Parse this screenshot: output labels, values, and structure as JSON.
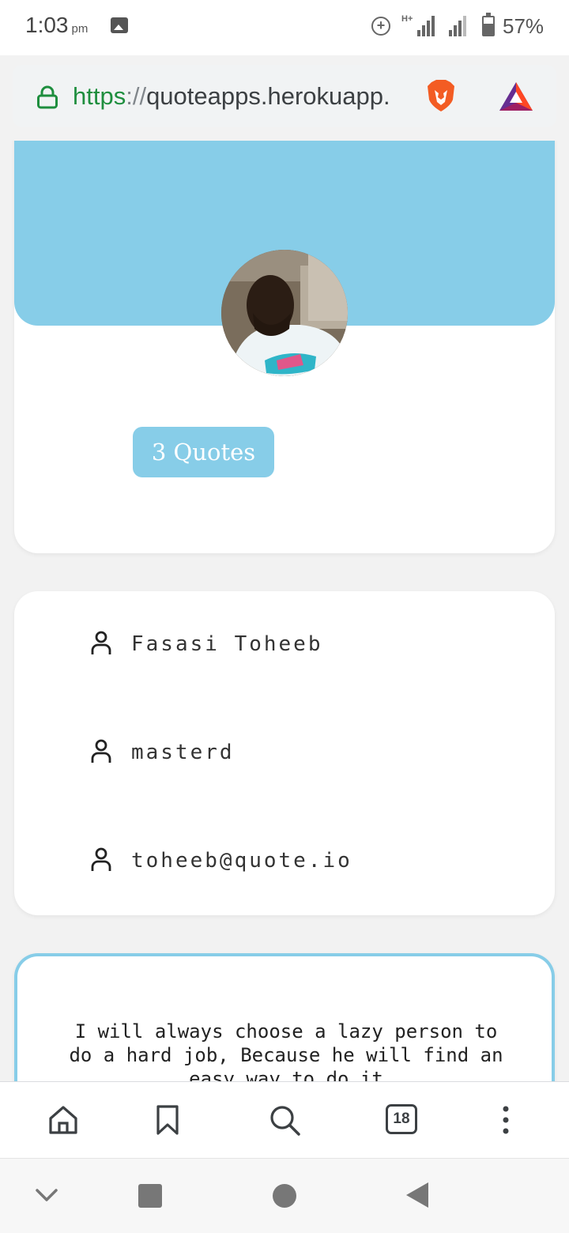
{
  "status_bar": {
    "time": "1:03",
    "ampm": "pm",
    "network": "H+",
    "battery": "57%"
  },
  "browser": {
    "url_scheme": "https",
    "url_separator": "://",
    "url_host": "quoteapps.herokuapp.",
    "tab_count": "18"
  },
  "profile": {
    "quotes_badge": "3 Quotes"
  },
  "user_info": {
    "full_name": "Fasasi Toheeb",
    "username": "masterd",
    "email": "toheeb@quote.io"
  },
  "quote": {
    "text": "I will always choose a lazy person to do a hard job, Because he will find an easy way to do it"
  },
  "colors": {
    "accent": "#87cde8",
    "url_green": "#1e8e3e"
  }
}
